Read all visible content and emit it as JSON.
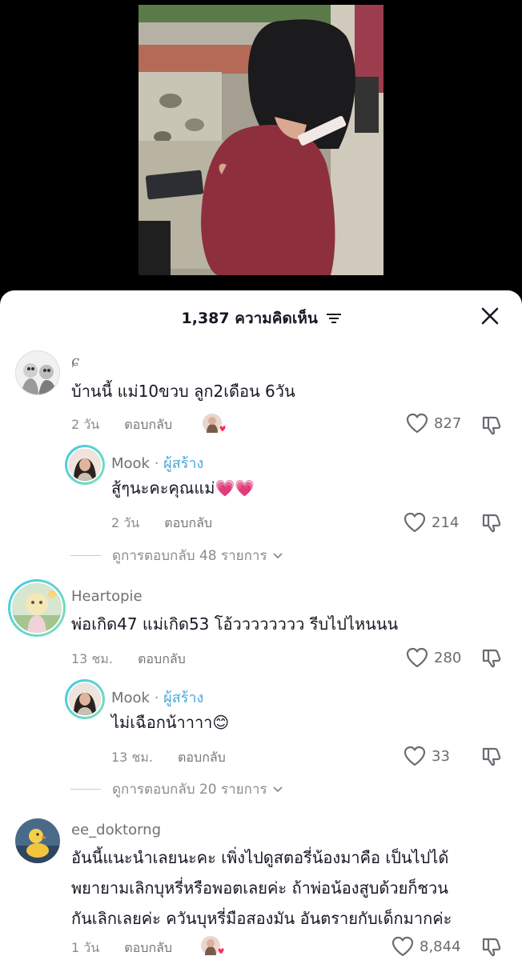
{
  "header": {
    "comment_count": "1,387",
    "comments_word": "ความคิดเห็น"
  },
  "comments": [
    {
      "username": "ɕ",
      "text": "บ้านนี้ แม่10ขวบ ลูก2เดือน 6วัน",
      "time": "2 วัน",
      "reply_label": "ตอบกลับ",
      "likes": "827",
      "replies": [
        {
          "username": "Mook",
          "creator_label": "· ผู้สร้าง",
          "text": "สู้ๆนะคะคุณแม่💗💗",
          "time": "2 วัน",
          "reply_label": "ตอบกลับ",
          "likes": "214"
        }
      ],
      "view_replies": "ดูการตอบกลับ 48 รายการ"
    },
    {
      "username": "Heartopie",
      "text": "พ่อเกิด47 แม่เกิด53 โอ้วววววววว รีบไปไหนนน",
      "time": "13 ชม.",
      "reply_label": "ตอบกลับ",
      "likes": "280",
      "replies": [
        {
          "username": "Mook",
          "creator_label": "· ผู้สร้าง",
          "text": "ไม่เฉือกน้าาาา😊",
          "time": "13 ชม.",
          "reply_label": "ตอบกลับ",
          "likes": "33"
        }
      ],
      "view_replies": "ดูการตอบกลับ 20 รายการ"
    },
    {
      "username": "ee_doktorng",
      "text_lines": [
        "อันนี้แนะนำเลยนะคะ เพิ่งไปดูสตอรี่น้องมาคือ เป็นไปได้",
        "พยายามเลิกบุหรี่หรือพอตเลยค่ะ ถ้าพ่อน้องสูบด้วยก็ชวน",
        "กันเลิกเลยค่ะ ควันบุหรี่มือสองมัน อันตรายกับเด็กมากค่ะ"
      ],
      "time": "1 วัน",
      "reply_label": "ตอบกลับ",
      "likes": "8,844"
    }
  ],
  "colors": {
    "sheet_bg": "#ffffff",
    "creator_blue": "#4aa8d8",
    "heart_red": "#fe2c55",
    "story_ring": "#41c9e2"
  },
  "icons": [
    "filter-icon",
    "close-icon",
    "heart-icon",
    "dislike-icon",
    "chevron-down-icon"
  ]
}
